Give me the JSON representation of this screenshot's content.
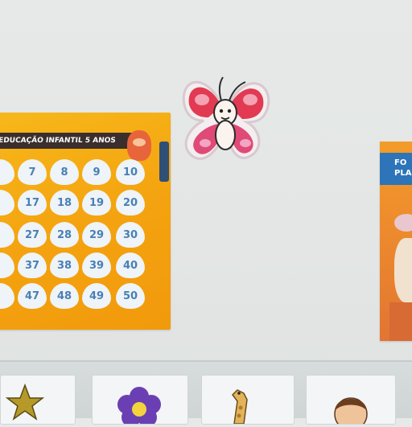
{
  "scene": {
    "wall_color": "#e4e7e6"
  },
  "poster_left": {
    "banner_text": "EDUCAÇÃO INFANTIL 5 ANOS",
    "background_color": "#f4a20f",
    "numbers": [
      [
        "",
        "7",
        "8",
        "9",
        "10"
      ],
      [
        "",
        "17",
        "18",
        "19",
        "20"
      ],
      [
        "",
        "27",
        "28",
        "29",
        "30"
      ],
      [
        "",
        "37",
        "38",
        "39",
        "40"
      ],
      [
        "",
        "47",
        "48",
        "49",
        "50"
      ]
    ]
  },
  "butterfly": {
    "icon": "butterfly-decoration",
    "wing_color": "#e23a52"
  },
  "poster_right": {
    "header_text_1": "FO",
    "header_text_2": "PLA",
    "header_color": "#2d74b8"
  },
  "bottom_strip": {
    "cards": [
      {
        "icon": "star-icon"
      },
      {
        "icon": "flower-icon"
      },
      {
        "icon": "giraffe-icon"
      },
      {
        "icon": "person-icon"
      }
    ]
  }
}
